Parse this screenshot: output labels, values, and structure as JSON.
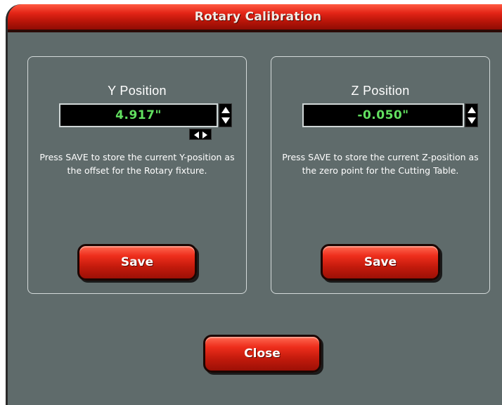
{
  "window": {
    "title": "Rotary Calibration"
  },
  "y_panel": {
    "title": "Y Position",
    "value": "4.917\"",
    "description": "Press SAVE to store the current Y-position as the offset for the Rotary fixture.",
    "save_label": "Save"
  },
  "z_panel": {
    "title": "Z Position",
    "value": "-0.050\"",
    "description": "Press SAVE to store the current Z-position as the zero point for the Cutting Table.",
    "save_label": "Save"
  },
  "footer": {
    "close_label": "Close"
  },
  "colors": {
    "accent_red": "#e32416",
    "value_green": "#62e060",
    "background": "#5f6b6b"
  }
}
